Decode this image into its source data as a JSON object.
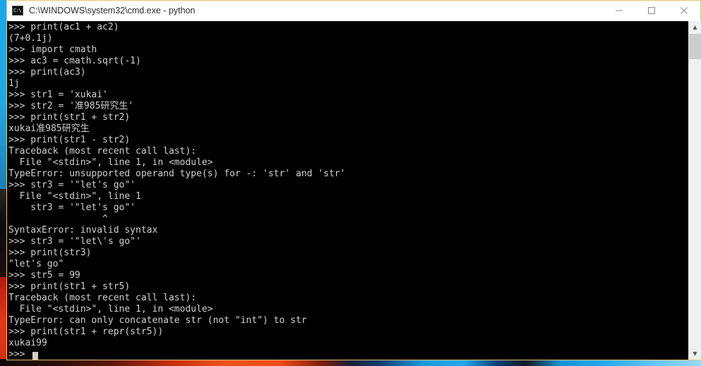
{
  "window": {
    "title": "C:\\WINDOWS\\system32\\cmd.exe - python",
    "icon": "cmd-console-icon",
    "border_color": "#e8c372",
    "titlebar_bg": "#ffffff",
    "controls": {
      "minimize_label": "—",
      "maximize_label": "□",
      "close_label": "✕"
    }
  },
  "terminal": {
    "background": "#000000",
    "foreground": "#d0d0d0",
    "cursor": "block",
    "lines": [
      ">>> print(ac1 + ac2)",
      "(7+0.1j)",
      ">>> import cmath",
      ">>> ac3 = cmath.sqrt(-1)",
      ">>> print(ac3)",
      "1j",
      ">>> str1 = 'xukai'",
      ">>> str2 = '准985研究生'",
      ">>> print(str1 + str2)",
      "xukai准985研究生",
      ">>> print(str1 - str2)",
      "Traceback (most recent call last):",
      "  File \"<stdin>\", line 1, in <module>",
      "TypeError: unsupported operand type(s) for -: 'str' and 'str'",
      ">>> str3 = '\"let's go\"'",
      "  File \"<stdin>\", line 1",
      "    str3 = '\"let's go\"'",
      "                 ^",
      "SyntaxError: invalid syntax",
      ">>> str3 = '\"let\\'s go\"'",
      ">>> print(str3)",
      "\"let's go\"",
      ">>> str5 = 99",
      ">>> print(str1 + str5)",
      "Traceback (most recent call last):",
      "  File \"<stdin>\", line 1, in <module>",
      "TypeError: can only concatenate str (not \"int\") to str",
      ">>> print(str1 + repr(str5))",
      "xukai99",
      ">>> "
    ],
    "full_text": ">>> print(ac1 + ac2)\n(7+0.1j)\n>>> import cmath\n>>> ac3 = cmath.sqrt(-1)\n>>> print(ac3)\n1j\n>>> str1 = 'xukai'\n>>> str2 = '准985研究生'\n>>> print(str1 + str2)\nxukai准985研究生\n>>> print(str1 - str2)\nTraceback (most recent call last):\n  File \"<stdin>\", line 1, in <module>\nTypeError: unsupported operand type(s) for -: 'str' and 'str'\n>>> str3 = '\"let's go\"'\n  File \"<stdin>\", line 1\n    str3 = '\"let's go\"'\n                 ^\nSyntaxError: invalid syntax\n>>> str3 = '\"let\\'s go\"'\n>>> print(str3)\n\"let's go\"\n>>> str5 = 99\n>>> print(str1 + str5)\nTraceback (most recent call last):\n  File \"<stdin>\", line 1, in <module>\nTypeError: can only concatenate str (not \"int\") to str\n>>> print(str1 + repr(str5))\nxukai99\n>>> "
  },
  "scrollbar": {
    "up_arrow": "▲",
    "down_arrow": "▼",
    "thumb_color": "#cdcdcd",
    "track_color": "#f0f0f0"
  }
}
